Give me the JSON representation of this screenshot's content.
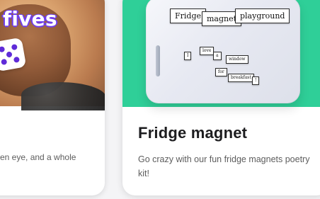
{
  "left_card": {
    "overlay_title": "fives",
    "snippet": "en eye, and a whole"
  },
  "right_card": {
    "title": "Fridge magnet",
    "description": "Go crazy with our fun fridge magnets poetry kit!",
    "magnets": {
      "top": [
        "Fridge",
        "magnet",
        "playground"
      ],
      "mid": [
        "I",
        "love",
        "a",
        "window"
      ],
      "low": [
        "for",
        "breakfast",
        "!"
      ]
    }
  },
  "colors": {
    "page_bg": "#f4f4f6",
    "card_bg": "#ffffff",
    "green_bg": "#2fcf98",
    "purple_accent": "#6e3cf0"
  }
}
